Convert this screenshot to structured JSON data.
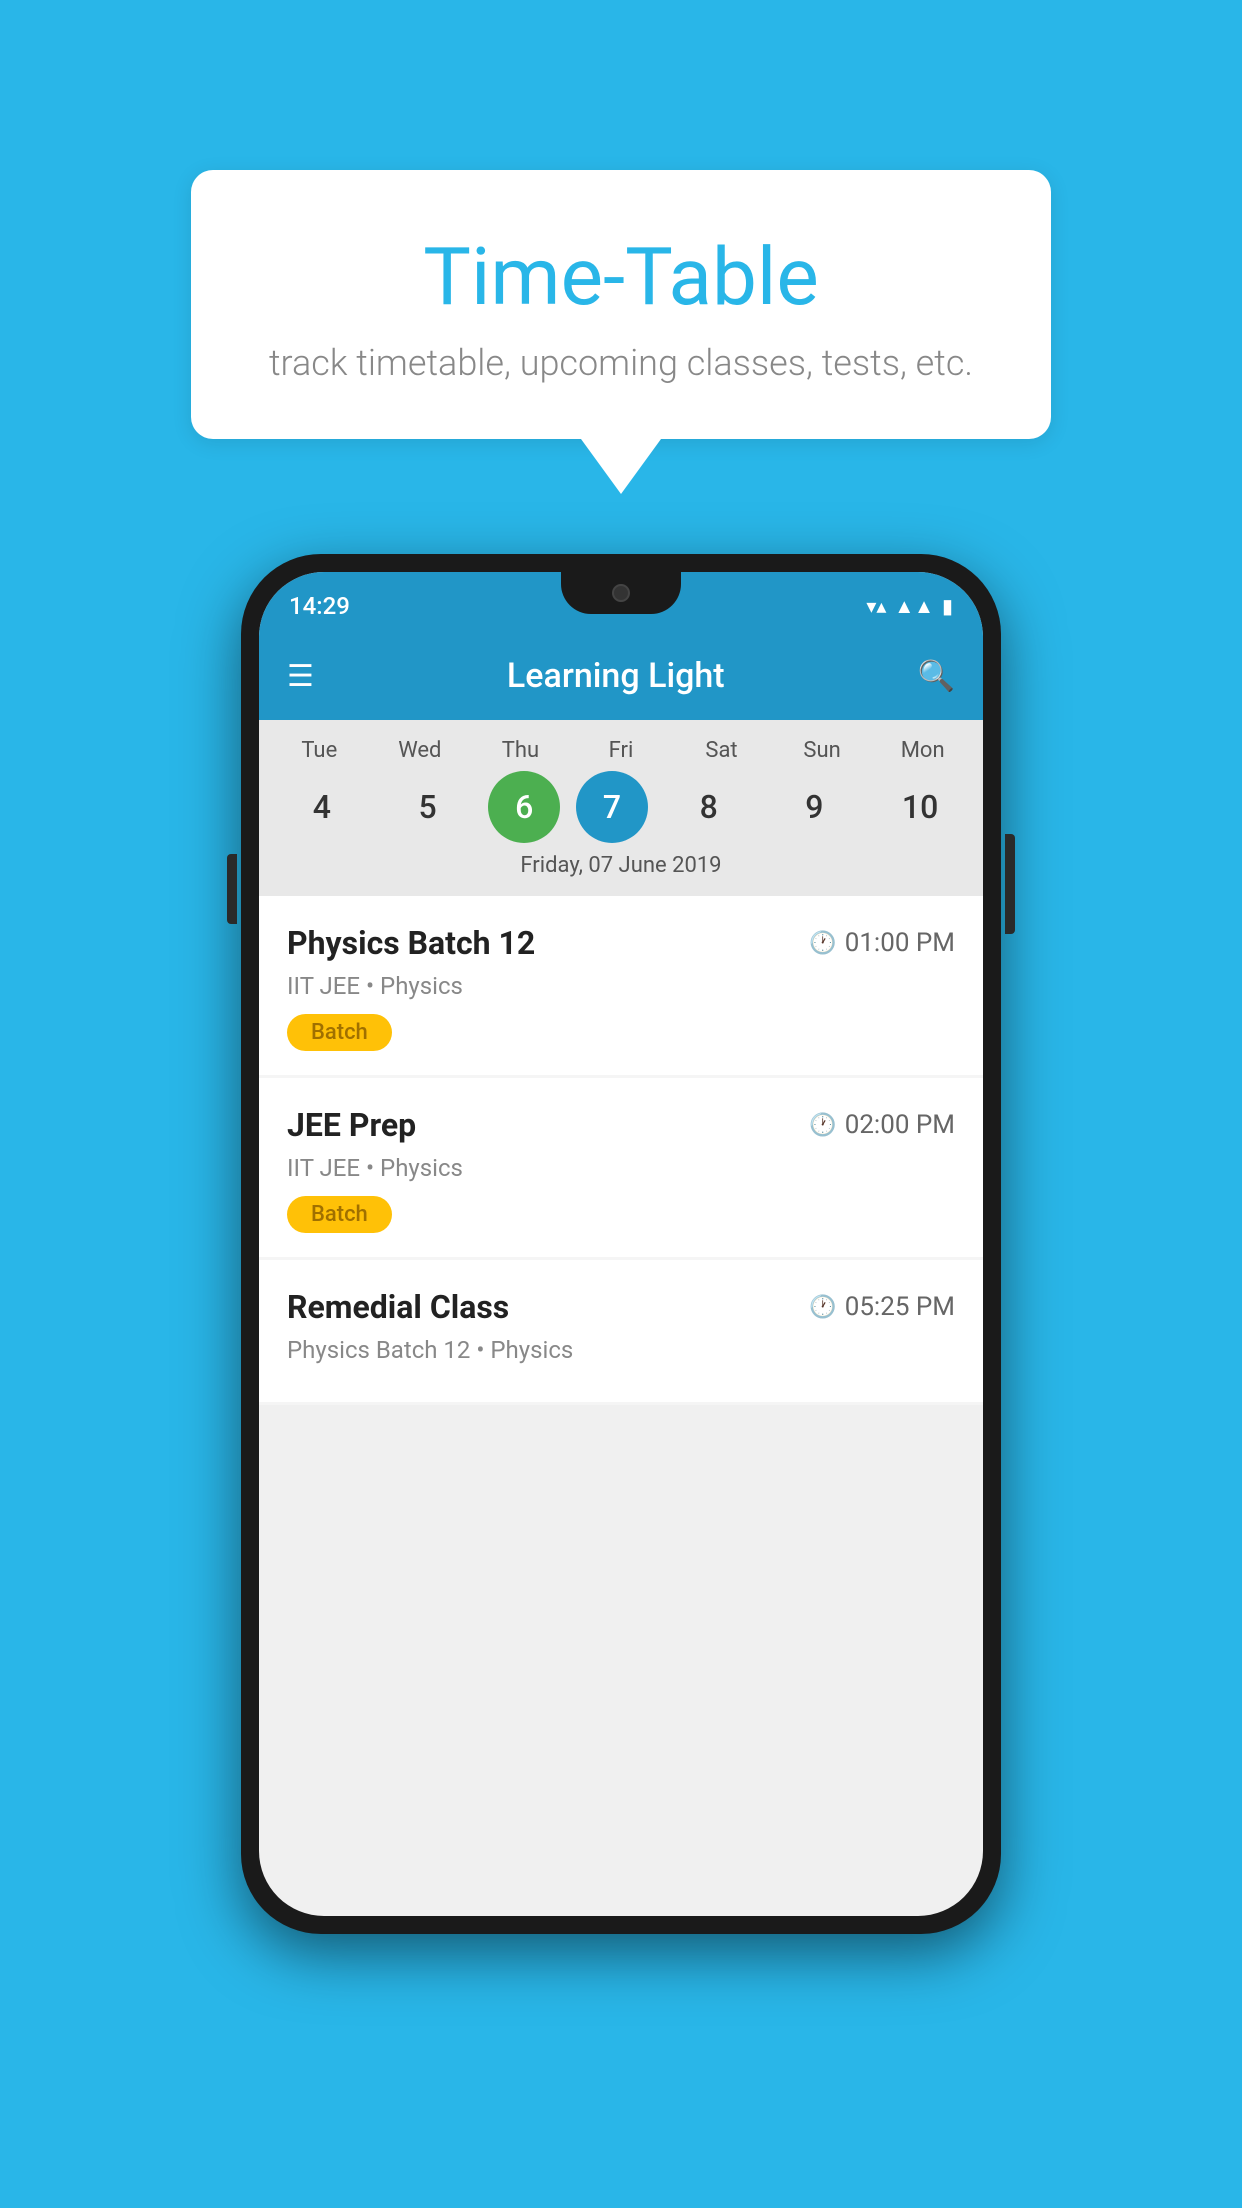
{
  "page": {
    "background_color": "#29b6e8"
  },
  "speech_bubble": {
    "title": "Time-Table",
    "subtitle": "track timetable, upcoming classes, tests, etc."
  },
  "phone": {
    "status_bar": {
      "time": "14:29"
    },
    "app_bar": {
      "title": "Learning Light",
      "hamburger_label": "☰",
      "search_label": "🔍"
    },
    "calendar": {
      "days": [
        {
          "name": "Tue",
          "num": "4",
          "state": "normal"
        },
        {
          "name": "Wed",
          "num": "5",
          "state": "normal"
        },
        {
          "name": "Thu",
          "num": "6",
          "state": "today"
        },
        {
          "name": "Fri",
          "num": "7",
          "state": "selected"
        },
        {
          "name": "Sat",
          "num": "8",
          "state": "normal"
        },
        {
          "name": "Sun",
          "num": "9",
          "state": "normal"
        },
        {
          "name": "Mon",
          "num": "10",
          "state": "normal"
        }
      ],
      "selected_date_label": "Friday, 07 June 2019"
    },
    "classes": [
      {
        "title": "Physics Batch 12",
        "time": "01:00 PM",
        "subtitle": "IIT JEE • Physics",
        "badge": "Batch"
      },
      {
        "title": "JEE Prep",
        "time": "02:00 PM",
        "subtitle": "IIT JEE • Physics",
        "badge": "Batch"
      },
      {
        "title": "Remedial Class",
        "time": "05:25 PM",
        "subtitle": "Physics Batch 12 • Physics",
        "badge": null
      }
    ]
  }
}
